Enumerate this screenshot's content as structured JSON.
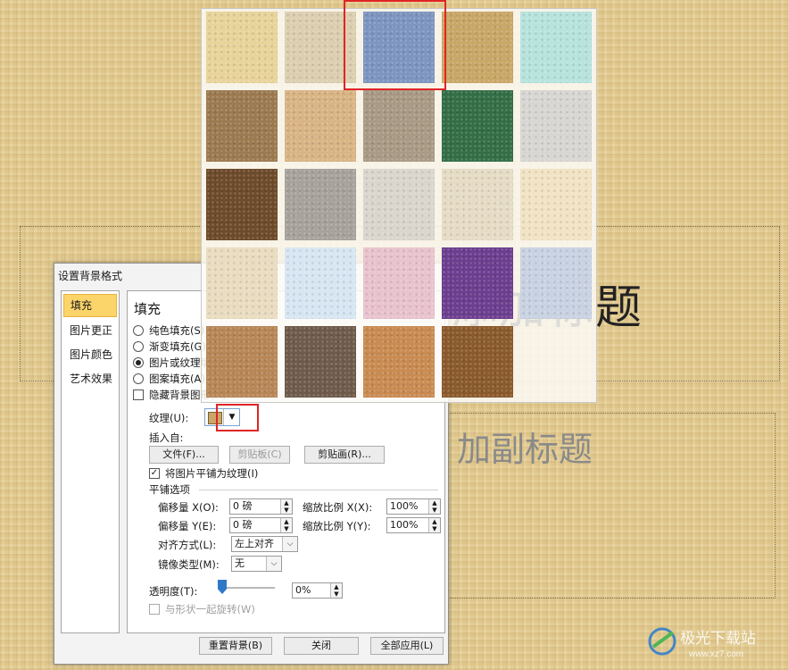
{
  "slide": {
    "title_placeholder": "添加标题",
    "subtitle_placeholder": "加副标题"
  },
  "dialog": {
    "title": "设置背景格式",
    "help": "?",
    "close": "✕",
    "nav": [
      "填充",
      "图片更正",
      "图片颜色",
      "艺术效果"
    ],
    "section_title": "填充",
    "fill_options": [
      {
        "label": "纯色填充(S)",
        "selected": false
      },
      {
        "label": "渐变填充(G)",
        "selected": false
      },
      {
        "label": "图片或纹理填充(P)",
        "selected": true
      },
      {
        "label": "图案填充(A)",
        "selected": false
      }
    ],
    "hide_bg": "隐藏背景图形(H)",
    "texture_label": "纹理(U):",
    "insert_from": "插入自:",
    "file_btn": "文件(F)...",
    "clipboard_btn": "剪贴板(C)",
    "clipart_btn": "剪贴画(R)...",
    "tile_check": "将图片平铺为纹理(I)",
    "tile_options": "平铺选项",
    "offset_x_label": "偏移量 X(O):",
    "offset_x": "0 磅",
    "offset_y_label": "偏移量 Y(E):",
    "offset_y": "0 磅",
    "scale_x_label": "缩放比例 X(X):",
    "scale_x": "100%",
    "scale_y_label": "缩放比例 Y(Y):",
    "scale_y": "100%",
    "align_label": "对齐方式(L):",
    "align_value": "左上对齐",
    "mirror_label": "镜像类型(M):",
    "mirror_value": "无",
    "transparency_label": "透明度(T):",
    "transparency_value": "0%",
    "transparency_level": 0,
    "rotate_with_shape": "与形状一起旋转(W)",
    "reset_btn": "重置背景(B)",
    "close_btn": "关闭",
    "apply_all_btn": "全部应用(L)"
  },
  "textures": [
    {
      "name": "papyrus",
      "color": "#e8d39a",
      "selected": false
    },
    {
      "name": "canvas",
      "color": "#dccfb0",
      "selected": false
    },
    {
      "name": "denim",
      "color": "#7d95c0",
      "selected": true
    },
    {
      "name": "woven-mat",
      "color": "#c9a767",
      "selected": false
    },
    {
      "name": "water-droplets",
      "color": "#b7e3dd",
      "selected": false
    },
    {
      "name": "paper-bag",
      "color": "#9c7a50",
      "selected": false
    },
    {
      "name": "fish-fossil",
      "color": "#d9b484",
      "selected": false
    },
    {
      "name": "sand",
      "color": "#a89a84",
      "selected": false
    },
    {
      "name": "green-marble",
      "color": "#336e46",
      "selected": false
    },
    {
      "name": "white-marble",
      "color": "#d8d6d2",
      "selected": false
    },
    {
      "name": "brown-marble",
      "color": "#6d4a2a",
      "selected": false
    },
    {
      "name": "granite",
      "color": "#a7a29b",
      "selected": false
    },
    {
      "name": "newsprint",
      "color": "#dad6cd",
      "selected": false
    },
    {
      "name": "recycled-paper",
      "color": "#e6dcc5",
      "selected": false
    },
    {
      "name": "parchment",
      "color": "#f1e3c3",
      "selected": false
    },
    {
      "name": "stationery",
      "color": "#e9dcc0",
      "selected": false
    },
    {
      "name": "blue-tissue-paper",
      "color": "#d7e6f2",
      "selected": false
    },
    {
      "name": "pink-tissue-paper",
      "color": "#e8c3cd",
      "selected": false
    },
    {
      "name": "purple-mesh",
      "color": "#6c3e8f",
      "selected": false
    },
    {
      "name": "bouquet",
      "color": "#c8d2e2",
      "selected": false
    },
    {
      "name": "cork",
      "color": "#b88657",
      "selected": false
    },
    {
      "name": "walnut",
      "color": "#6e5b4b",
      "selected": false
    },
    {
      "name": "oak",
      "color": "#c98b52",
      "selected": false
    },
    {
      "name": "medium-wood",
      "color": "#8b5a2c",
      "selected": false
    }
  ],
  "watermark": {
    "text": "极光下载站",
    "url": "www.xz7.com"
  }
}
